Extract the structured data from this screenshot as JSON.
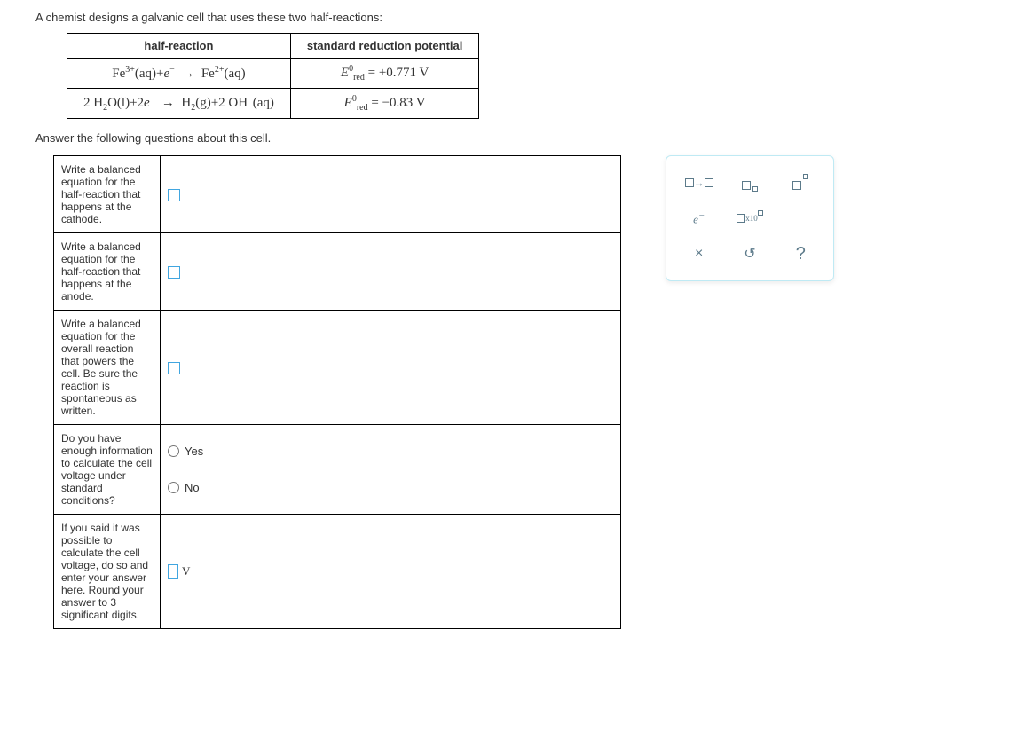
{
  "prompt": "A chemist designs a galvanic cell that uses these two half-reactions:",
  "table": {
    "headers": {
      "left": "half-reaction",
      "right": "standard reduction potential"
    },
    "row1": {
      "reaction_html": "Fe<sup>3+</sup>(aq)+<i>e</i><sup>−</sup> &nbsp;→&nbsp; Fe<sup>2+</sup>(aq)",
      "pot_prefix": "E",
      "pot_sup": "0",
      "pot_sub": "red",
      "pot_val": " = +0.771 V"
    },
    "row2": {
      "reaction_html": "2 H<sub>2</sub>O(l)+2<i>e</i><sup>−</sup> &nbsp;→&nbsp; H<sub>2</sub>(g)+2 OH<sup>−</sup>(aq)",
      "pot_prefix": "E",
      "pot_sup": "0",
      "pot_sub": "red",
      "pot_val": " = −0.83 V"
    }
  },
  "subprompt": "Answer the following questions about this cell.",
  "q": {
    "cathode": "Write a balanced equation for the half-reaction that happens at the cathode.",
    "anode": "Write a balanced equation for the half-reaction that happens at the anode.",
    "overall": "Write a balanced equation for the overall reaction that powers the cell. Be sure the reaction is spontaneous as written.",
    "enough": "Do you have enough information to calculate the cell voltage under standard conditions?",
    "yes": "Yes",
    "no": "No",
    "voltage": "If you said it was possible to calculate the cell voltage, do so and enter your answer here. Round your answer to 3 significant digits.",
    "unit": "V"
  },
  "toolbox": {
    "arrow": "→",
    "e": "e",
    "x10": "x10",
    "times": "×",
    "reset": "↺",
    "help": "?"
  }
}
